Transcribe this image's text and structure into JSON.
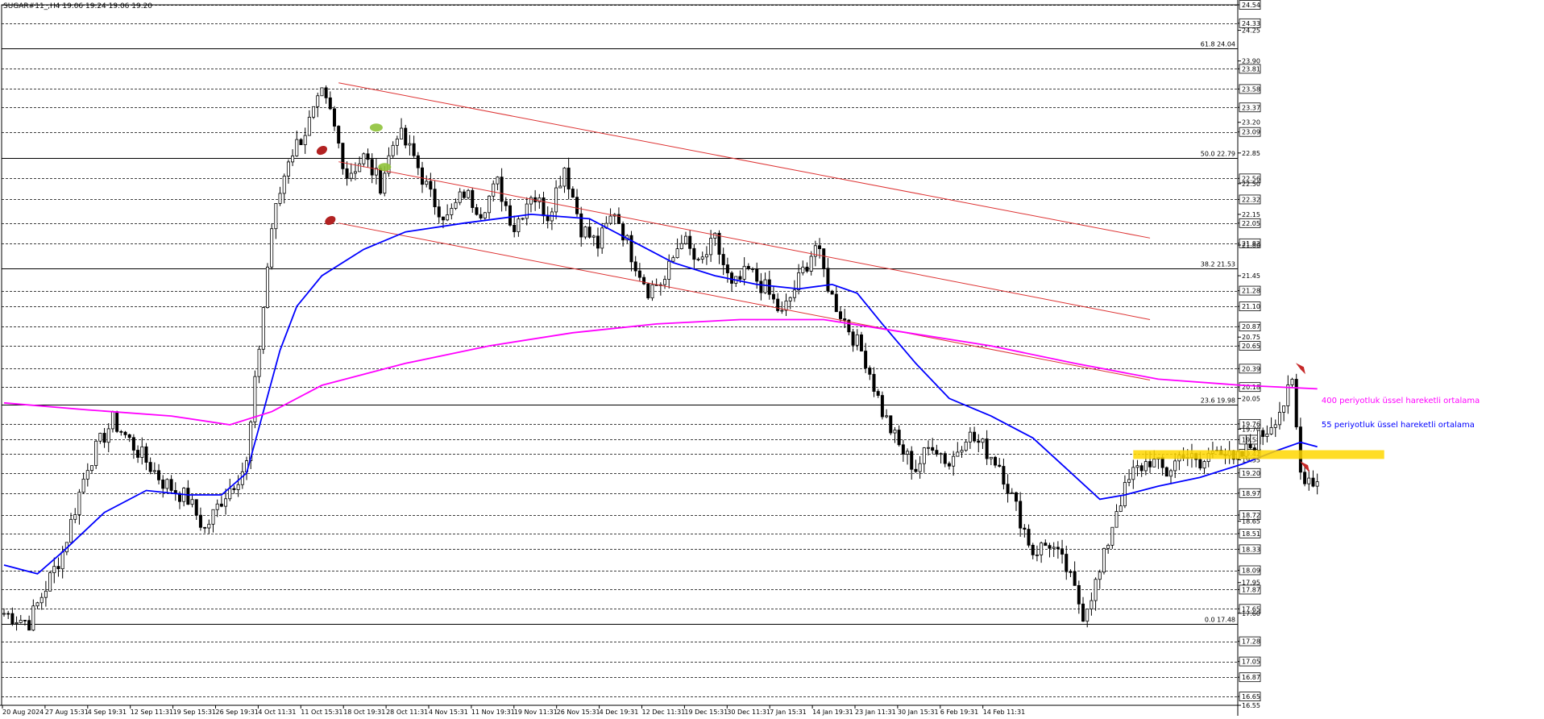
{
  "header": {
    "symbol_text": "SUGAR#11_,H4  19.06 19.24 19.06 19.20"
  },
  "chart_data": {
    "type": "candlestick",
    "timeframe": "H4",
    "price_range": [
      16.55,
      24.54
    ],
    "price_ticks": [
      {
        "value": 24.54,
        "label": "24.54",
        "boxed": true
      },
      {
        "value": 24.33,
        "label": "24.33",
        "boxed": true
      },
      {
        "value": 24.25,
        "label": "24.25",
        "boxed": false
      },
      {
        "value": 23.9,
        "label": "23.90",
        "boxed": false
      },
      {
        "value": 23.81,
        "label": "23.81",
        "boxed": true
      },
      {
        "value": 23.58,
        "label": "23.58",
        "boxed": true
      },
      {
        "value": 23.37,
        "label": "23.37",
        "boxed": true
      },
      {
        "value": 23.2,
        "label": "23.20",
        "boxed": false
      },
      {
        "value": 23.09,
        "label": "23.09",
        "boxed": true
      },
      {
        "value": 22.85,
        "label": "22.85",
        "boxed": false
      },
      {
        "value": 22.56,
        "label": "22.56",
        "boxed": true
      },
      {
        "value": 22.5,
        "label": "22.50",
        "boxed": false
      },
      {
        "value": 22.32,
        "label": "22.32",
        "boxed": true
      },
      {
        "value": 22.15,
        "label": "22.15",
        "boxed": false
      },
      {
        "value": 22.05,
        "label": "22.05",
        "boxed": true
      },
      {
        "value": 21.82,
        "label": "21.82",
        "boxed": true
      },
      {
        "value": 21.8,
        "label": "21.80",
        "boxed": false
      },
      {
        "value": 21.45,
        "label": "21.45",
        "boxed": false
      },
      {
        "value": 21.28,
        "label": "21.28",
        "boxed": true
      },
      {
        "value": 21.1,
        "label": "21.10",
        "boxed": true
      },
      {
        "value": 20.87,
        "label": "20.87",
        "boxed": true
      },
      {
        "value": 20.75,
        "label": "20.75",
        "boxed": false
      },
      {
        "value": 20.65,
        "label": "20.65",
        "boxed": true
      },
      {
        "value": 20.39,
        "label": "20.39",
        "boxed": true
      },
      {
        "value": 20.18,
        "label": "20.18",
        "boxed": true
      },
      {
        "value": 20.05,
        "label": "20.05",
        "boxed": false
      },
      {
        "value": 19.76,
        "label": "19.76",
        "boxed": true
      },
      {
        "value": 19.7,
        "label": "19.70",
        "boxed": false
      },
      {
        "value": 19.58,
        "label": "19.58",
        "boxed": true
      },
      {
        "value": 19.42,
        "label": "19.42",
        "boxed": true
      },
      {
        "value": 19.35,
        "label": "19.35",
        "boxed": false
      },
      {
        "value": 19.2,
        "label": "19.20",
        "boxed": true
      },
      {
        "value": 18.97,
        "label": "18.97",
        "boxed": true
      },
      {
        "value": 18.72,
        "label": "18.72",
        "boxed": true
      },
      {
        "value": 18.65,
        "label": "18.65",
        "boxed": false
      },
      {
        "value": 18.51,
        "label": "18.51",
        "boxed": true
      },
      {
        "value": 18.33,
        "label": "18.33",
        "boxed": true
      },
      {
        "value": 18.09,
        "label": "18.09",
        "boxed": true
      },
      {
        "value": 17.95,
        "label": "17.95",
        "boxed": false
      },
      {
        "value": 17.87,
        "label": "17.87",
        "boxed": true
      },
      {
        "value": 17.65,
        "label": "17.65",
        "boxed": true
      },
      {
        "value": 17.6,
        "label": "17.60",
        "boxed": false
      },
      {
        "value": 17.28,
        "label": "17.28",
        "boxed": true
      },
      {
        "value": 17.05,
        "label": "17.05",
        "boxed": true
      },
      {
        "value": 16.87,
        "label": "16.87",
        "boxed": true
      },
      {
        "value": 16.65,
        "label": "16.65",
        "boxed": true
      },
      {
        "value": 16.55,
        "label": "16.55",
        "boxed": false
      }
    ],
    "dashed_levels": [
      24.54,
      24.33,
      23.81,
      23.58,
      23.37,
      23.09,
      22.56,
      22.32,
      22.05,
      21.82,
      21.28,
      21.1,
      20.87,
      20.65,
      20.39,
      20.18,
      19.76,
      19.58,
      19.42,
      19.2,
      18.97,
      18.72,
      18.51,
      18.33,
      18.09,
      17.87,
      17.65,
      17.28,
      17.05,
      16.87,
      16.65
    ],
    "fibonacci_levels": [
      {
        "price": 24.04,
        "label": "61.8 24.04"
      },
      {
        "price": 22.79,
        "label": "50.0 22.79"
      },
      {
        "price": 21.53,
        "label": "38.2 21.53"
      },
      {
        "price": 19.98,
        "label": "23.6 19.98"
      },
      {
        "price": 17.48,
        "label": "0.0 17.48"
      }
    ],
    "time_labels": [
      "20 Aug 2024",
      "27 Aug 15:31",
      "4 Sep 19:31",
      "12 Sep 11:31",
      "19 Sep 15:31",
      "26 Sep 19:31",
      "4 Oct 11:31",
      "11 Oct 15:31",
      "18 Oct 19:31",
      "28 Oct 11:31",
      "4 Nov 15:31",
      "11 Nov 19:31",
      "19 Nov 11:31",
      "26 Nov 15:31",
      "4 Dec 19:31",
      "12 Dec 11:31",
      "19 Dec 15:31",
      "30 Dec 11:31",
      "7 Jan 15:31",
      "14 Jan 19:31",
      "23 Jan 11:31",
      "30 Jan 15:31",
      "6 Feb 19:31",
      "14 Feb 11:31"
    ],
    "candles": {
      "count": 345,
      "waypoints": [
        [
          0,
          17.6
        ],
        [
          6,
          17.5
        ],
        [
          10,
          17.9
        ],
        [
          14,
          18.3
        ],
        [
          20,
          19.3
        ],
        [
          26,
          19.8
        ],
        [
          32,
          19.45
        ],
        [
          38,
          19.1
        ],
        [
          44,
          18.9
        ],
        [
          48,
          18.55
        ],
        [
          52,
          18.9
        ],
        [
          58,
          19.3
        ],
        [
          64,
          22.0
        ],
        [
          68,
          22.8
        ],
        [
          72,
          23.1
        ],
        [
          76,
          23.5
        ],
        [
          78,
          23.3
        ],
        [
          82,
          22.6
        ],
        [
          86,
          22.8
        ],
        [
          90,
          22.5
        ],
        [
          94,
          23.1
        ],
        [
          98,
          22.8
        ],
        [
          102,
          22.35
        ],
        [
          106,
          22.1
        ],
        [
          110,
          22.4
        ],
        [
          114,
          22.2
        ],
        [
          118,
          22.5
        ],
        [
          122,
          22.0
        ],
        [
          126,
          22.4
        ],
        [
          130,
          22.15
        ],
        [
          134,
          22.7
        ],
        [
          138,
          22.0
        ],
        [
          142,
          21.8
        ],
        [
          146,
          22.2
        ],
        [
          150,
          21.7
        ],
        [
          154,
          21.3
        ],
        [
          158,
          21.4
        ],
        [
          162,
          21.9
        ],
        [
          166,
          21.55
        ],
        [
          170,
          21.85
        ],
        [
          174,
          21.3
        ],
        [
          178,
          21.5
        ],
        [
          182,
          21.3
        ],
        [
          186,
          21.0
        ],
        [
          190,
          21.4
        ],
        [
          194,
          21.8
        ],
        [
          198,
          21.2
        ],
        [
          202,
          20.85
        ],
        [
          206,
          20.5
        ],
        [
          210,
          19.9
        ],
        [
          214,
          19.5
        ],
        [
          218,
          19.25
        ],
        [
          222,
          19.55
        ],
        [
          226,
          19.3
        ],
        [
          230,
          19.65
        ],
        [
          234,
          19.5
        ],
        [
          238,
          19.3
        ],
        [
          242,
          18.8
        ],
        [
          246,
          18.3
        ],
        [
          250,
          18.4
        ],
        [
          254,
          18.1
        ],
        [
          258,
          17.6
        ],
        [
          262,
          18.05
        ],
        [
          266,
          18.8
        ],
        [
          270,
          19.2
        ],
        [
          274,
          19.35
        ],
        [
          278,
          19.2
        ],
        [
          282,
          19.45
        ],
        [
          286,
          19.25
        ],
        [
          290,
          19.55
        ],
        [
          294,
          19.3
        ],
        [
          298,
          19.5
        ],
        [
          302,
          19.7
        ],
        [
          306,
          20.0
        ],
        [
          308,
          20.2
        ],
        [
          310,
          19.2
        ],
        [
          314,
          19.1
        ]
      ],
      "bullish_color": "#000000",
      "bearish_color": "#000000"
    },
    "moving_averages": [
      {
        "name": "55 periyotluk üssel hareketli ortalama",
        "color": "#0000ff",
        "points": [
          [
            0,
            18.15
          ],
          [
            8,
            18.05
          ],
          [
            14,
            18.3
          ],
          [
            24,
            18.75
          ],
          [
            34,
            19.0
          ],
          [
            44,
            18.95
          ],
          [
            52,
            18.95
          ],
          [
            58,
            19.2
          ],
          [
            62,
            19.9
          ],
          [
            66,
            20.6
          ],
          [
            70,
            21.1
          ],
          [
            76,
            21.45
          ],
          [
            86,
            21.75
          ],
          [
            96,
            21.95
          ],
          [
            110,
            22.05
          ],
          [
            126,
            22.15
          ],
          [
            140,
            22.1
          ],
          [
            150,
            21.85
          ],
          [
            160,
            21.6
          ],
          [
            170,
            21.45
          ],
          [
            180,
            21.35
          ],
          [
            190,
            21.3
          ],
          [
            198,
            21.35
          ],
          [
            204,
            21.25
          ],
          [
            210,
            20.9
          ],
          [
            218,
            20.45
          ],
          [
            226,
            20.05
          ],
          [
            236,
            19.85
          ],
          [
            246,
            19.6
          ],
          [
            254,
            19.25
          ],
          [
            262,
            18.9
          ],
          [
            268,
            18.95
          ],
          [
            276,
            19.05
          ],
          [
            286,
            19.15
          ],
          [
            296,
            19.3
          ],
          [
            304,
            19.45
          ],
          [
            310,
            19.55
          ],
          [
            314,
            19.5
          ]
        ]
      },
      {
        "name": "400 periyotluk üssel hareketli ortalama",
        "color": "#ff00ff",
        "points": [
          [
            0,
            20.0
          ],
          [
            20,
            19.92
          ],
          [
            40,
            19.85
          ],
          [
            54,
            19.75
          ],
          [
            64,
            19.9
          ],
          [
            76,
            20.2
          ],
          [
            96,
            20.45
          ],
          [
            116,
            20.65
          ],
          [
            136,
            20.8
          ],
          [
            156,
            20.9
          ],
          [
            176,
            20.95
          ],
          [
            196,
            20.95
          ],
          [
            216,
            20.8
          ],
          [
            236,
            20.65
          ],
          [
            256,
            20.45
          ],
          [
            276,
            20.27
          ],
          [
            296,
            20.2
          ],
          [
            314,
            20.16
          ]
        ]
      }
    ],
    "channel_lines": [
      {
        "name": "channel-upper",
        "from": [
          80,
          23.65
        ],
        "to": [
          274,
          21.88
        ]
      },
      {
        "name": "channel-middle",
        "from": [
          80,
          22.75
        ],
        "to": [
          274,
          20.95
        ]
      },
      {
        "name": "channel-lower",
        "from": [
          80,
          22.05
        ],
        "to": [
          274,
          20.26
        ]
      }
    ],
    "zone": {
      "name": "yellow-resistance-zone",
      "from": 270,
      "to": 330,
      "price_top": 19.46,
      "price_bottom": 19.36,
      "color": "#ffd700"
    },
    "annotations": [
      {
        "text": "400 periyotluk üssel hareketli ortalama",
        "color": "#ff00ff",
        "bar": 315,
        "price": 20.0
      },
      {
        "text": "55 periyotluk üssel hareketli ortalama",
        "color": "#0000ff",
        "bar": 315,
        "price": 19.72
      }
    ],
    "markers": [
      {
        "kind": "red-dot",
        "bar": 76,
        "price": 22.88
      },
      {
        "kind": "red-dot",
        "bar": 78,
        "price": 22.08
      },
      {
        "kind": "green-dot",
        "bar": 89,
        "price": 23.14
      },
      {
        "kind": "green-dot",
        "bar": 91,
        "price": 22.69
      },
      {
        "kind": "red-arrow-down",
        "bar": 310,
        "price": 20.4
      },
      {
        "kind": "red-arrow-down",
        "bar": 311,
        "price": 19.28
      }
    ]
  }
}
